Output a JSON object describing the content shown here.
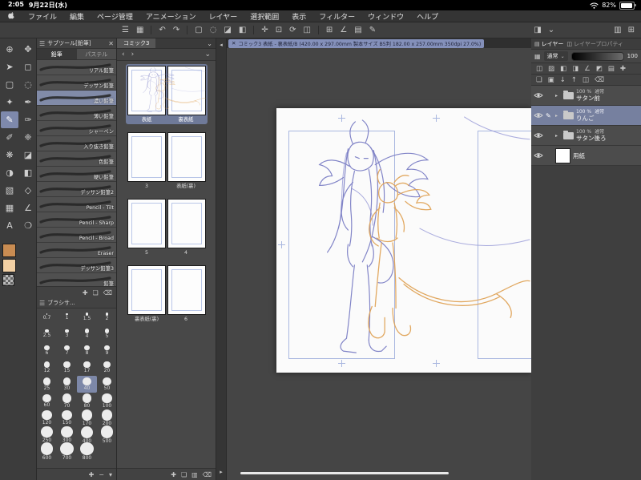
{
  "icons_map": {
    "close": "✕",
    "chevron_down": "⌄",
    "chevron_right": "▸",
    "pen": "✎",
    "collapse_left": "◂",
    "collapse_right": "▸",
    "prev": "‹",
    "next": "›",
    "panel_menu": "☰",
    "panel_plus": "⊞"
  },
  "statusbar": {
    "time": "2:05",
    "date": "9月22日(水)",
    "battery": "82%"
  },
  "menubar": {
    "items": [
      {
        "name": "menu-file",
        "label": "ファイル"
      },
      {
        "name": "menu-edit",
        "label": "編集"
      },
      {
        "name": "menu-page-manage",
        "label": "ページ管理"
      },
      {
        "name": "menu-animation",
        "label": "アニメーション"
      },
      {
        "name": "menu-layer",
        "label": "レイヤー"
      },
      {
        "name": "menu-selection",
        "label": "選択範囲"
      },
      {
        "name": "menu-view",
        "label": "表示"
      },
      {
        "name": "menu-filter",
        "label": "フィルター"
      },
      {
        "name": "menu-window",
        "label": "ウィンドウ"
      },
      {
        "name": "menu-help",
        "label": "ヘルプ"
      }
    ]
  },
  "toolbar": {
    "icons": [
      {
        "name": "main-menu-icon",
        "glyph": "☰"
      },
      {
        "name": "workspace-icon",
        "glyph": "▦"
      },
      {
        "name": "separator",
        "glyph": "",
        "sep": true
      },
      {
        "name": "undo-icon",
        "glyph": "↶"
      },
      {
        "name": "redo-icon",
        "glyph": "↷"
      },
      {
        "name": "separator",
        "glyph": "",
        "sep": true
      },
      {
        "name": "deselect-icon",
        "glyph": "▢"
      },
      {
        "name": "select-lasso-icon",
        "glyph": "◌"
      },
      {
        "name": "eraser-icon",
        "glyph": "◪"
      },
      {
        "name": "fill-icon",
        "glyph": "◧"
      },
      {
        "name": "separator",
        "glyph": "",
        "sep": true
      },
      {
        "name": "move-icon",
        "glyph": "✛"
      },
      {
        "name": "transform-icon",
        "glyph": "⊡"
      },
      {
        "name": "rotate-canvas-icon",
        "glyph": "⟳"
      },
      {
        "name": "flip-canvas-icon",
        "glyph": "◫"
      },
      {
        "name": "separator",
        "glyph": "",
        "sep": true
      },
      {
        "name": "grid-icon",
        "glyph": "⊞"
      },
      {
        "name": "snap-ruler-icon",
        "glyph": "∠"
      },
      {
        "name": "material-icon",
        "glyph": "▤"
      },
      {
        "name": "pen-quick-icon",
        "glyph": "✎"
      }
    ],
    "right_icons": [
      {
        "name": "clip-at-layer-icon",
        "glyph": "◨"
      },
      {
        "name": "palette-collapse-icon",
        "glyph": "⌄"
      },
      {
        "name": "gap",
        "glyph": "",
        "gap": true
      },
      {
        "name": "hide-palettes-icon",
        "glyph": "▥"
      },
      {
        "name": "add-palette-icon",
        "glyph": "⊞"
      }
    ]
  },
  "tools": {
    "items": [
      {
        "name": "zoom-tool",
        "glyph": "⊕"
      },
      {
        "name": "hand-tool",
        "glyph": "✥"
      },
      {
        "name": "operation-tool",
        "glyph": "➤"
      },
      {
        "name": "layer-move-tool",
        "glyph": "◻"
      },
      {
        "name": "marquee-select-tool",
        "glyph": "▢"
      },
      {
        "name": "lasso-select-tool",
        "glyph": "◌"
      },
      {
        "name": "auto-select-tool",
        "glyph": "✦"
      },
      {
        "name": "eyedropper-tool",
        "glyph": "✒"
      },
      {
        "name": "pencil-tool",
        "glyph": "✎",
        "selected": true
      },
      {
        "name": "pen-tool",
        "glyph": "✑"
      },
      {
        "name": "brush-tool",
        "glyph": "✐"
      },
      {
        "name": "airbrush-tool",
        "glyph": "❈"
      },
      {
        "name": "decoration-tool",
        "glyph": "❋"
      },
      {
        "name": "eraser-tool",
        "glyph": "◪"
      },
      {
        "name": "blend-tool",
        "glyph": "◑"
      },
      {
        "name": "fill-tool",
        "glyph": "◧"
      },
      {
        "name": "gradient-tool",
        "glyph": "▧"
      },
      {
        "name": "figure-tool",
        "glyph": "◇"
      },
      {
        "name": "frame-border-tool",
        "glyph": "▦"
      },
      {
        "name": "ruler-tool",
        "glyph": "∠"
      },
      {
        "name": "text-tool",
        "glyph": "A"
      },
      {
        "name": "balloon-tool",
        "glyph": "❍"
      }
    ],
    "main_color": "#c98c52",
    "sub_color": "#f2d0a4"
  },
  "subtool": {
    "title": "サブツール[鉛筆]",
    "tabs": [
      {
        "label": "鉛筆",
        "selected": true
      },
      {
        "label": "パステル"
      }
    ],
    "items": [
      {
        "label": "リアル鉛筆"
      },
      {
        "label": "デッサン鉛筆"
      },
      {
        "label": "濃い鉛筆",
        "selected": true
      },
      {
        "label": "薄い鉛筆"
      },
      {
        "label": "シャーペン"
      },
      {
        "label": "入り抜き鉛筆"
      },
      {
        "label": "色鉛筆"
      },
      {
        "label": "硬い鉛筆"
      },
      {
        "label": "デッサン鉛筆2"
      },
      {
        "label": "Pencil - Tilt"
      },
      {
        "label": "Pencil - Sharp"
      },
      {
        "label": "Pencil - Broad"
      },
      {
        "label": "Eraser"
      },
      {
        "label": "デッサン鉛筆3"
      },
      {
        "label": "鉛筆"
      }
    ],
    "footer_icons": [
      {
        "name": "add-subtool-icon",
        "glyph": "✚"
      },
      {
        "name": "duplicate-subtool-icon",
        "glyph": "❏"
      },
      {
        "name": "delete-subtool-icon",
        "glyph": "⌫"
      }
    ]
  },
  "brushsize": {
    "title": "ブラシサ...",
    "sizes": [
      "0.7",
      "1",
      "1.5",
      "2",
      "2.5",
      "3",
      "4",
      "5",
      "6",
      "7",
      "8",
      "9",
      "12",
      "15",
      "17",
      "20",
      "25",
      "30",
      "40",
      "50",
      "60",
      "70",
      "80",
      "100",
      "120",
      "150",
      "170",
      "200",
      "250",
      "300",
      "400",
      "500",
      "600",
      "700",
      "800"
    ],
    "selected": "40",
    "footer_icons": [
      {
        "name": "add-size-icon",
        "glyph": "✚"
      },
      {
        "name": "remove-size-icon",
        "glyph": "−"
      },
      {
        "name": "size-menu-icon",
        "glyph": "▾"
      }
    ]
  },
  "pages": {
    "tab": "コミック3",
    "spreads": [
      {
        "left_label": "表紙",
        "right_label": "裏表紙",
        "selected": true,
        "has_art": true
      },
      {
        "left_label": "3",
        "right_label": "表紙(裏)"
      },
      {
        "left_label": "5",
        "right_label": "4"
      },
      {
        "left_label": "裏表紙(裏)",
        "right_label": "6"
      }
    ],
    "footer_icons": [
      {
        "name": "add-page-icon",
        "glyph": "✚"
      },
      {
        "name": "duplicate-page-icon",
        "glyph": "❏"
      },
      {
        "name": "spread-view-icon",
        "glyph": "▥"
      },
      {
        "name": "delete-page-icon",
        "glyph": "⌫"
      }
    ]
  },
  "document": {
    "tab_title": "コミック3 表紙 - 裏表紙/B (420.00 x 297.00mm 製本サイズ B5判 182.00 x 257.00mm 350dpi 27.0%)"
  },
  "layers": {
    "tabs": [
      {
        "name": "tab-layer",
        "icon": "▤",
        "label": "レイヤー",
        "selected": true
      },
      {
        "name": "tab-layer-property",
        "icon": "◫",
        "label": "レイヤープロパティ"
      }
    ],
    "blend_mode": "通常",
    "opacity": "100",
    "effect_icons": [
      {
        "name": "blend-indicator-icon",
        "glyph": "◫"
      },
      {
        "name": "lock-alpha-icon",
        "glyph": "▨"
      },
      {
        "name": "lock-layer-icon",
        "glyph": "◧"
      },
      {
        "name": "mask-icon",
        "glyph": "◨"
      },
      {
        "name": "ruler-layer-icon",
        "glyph": "∠"
      },
      {
        "name": "clip-below-icon",
        "glyph": "◩"
      },
      {
        "name": "reference-layer-icon",
        "glyph": "▤"
      },
      {
        "name": "layer-settings-icon",
        "glyph": "✚"
      }
    ],
    "ops_icons": [
      {
        "name": "new-layer-icon",
        "glyph": "❏"
      },
      {
        "name": "new-folder-icon",
        "glyph": "▣"
      },
      {
        "name": "merge-down-icon",
        "glyph": "↓"
      },
      {
        "name": "move-up-icon",
        "glyph": "↑"
      },
      {
        "name": "duplicate-layer-icon",
        "glyph": "◫"
      },
      {
        "name": "delete-layer-icon",
        "glyph": "⌫"
      }
    ],
    "items": [
      {
        "opacity": "100 %",
        "mode": "通常",
        "name": "サタン前"
      },
      {
        "opacity": "100 %",
        "mode": "通常",
        "name": "りんご",
        "selected": true
      },
      {
        "opacity": "100 %",
        "mode": "通常",
        "name": "サタン後ろ"
      },
      {
        "name": "用紙",
        "paper": true
      }
    ]
  }
}
